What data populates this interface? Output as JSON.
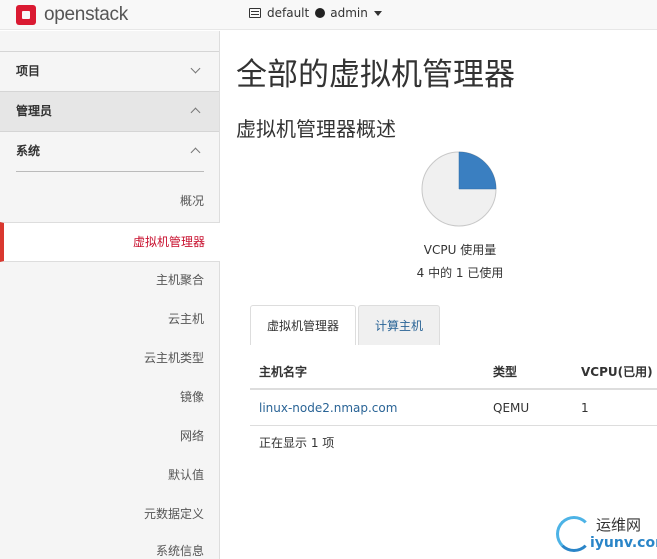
{
  "brand": {
    "name": "openstack"
  },
  "topbar": {
    "project": "default",
    "user": "admin"
  },
  "sidebar": {
    "project_label": "项目",
    "admin_label": "管理员",
    "system_label": "系统",
    "items": [
      {
        "label": "概况"
      },
      {
        "label": "虚拟机管理器"
      },
      {
        "label": "主机聚合"
      },
      {
        "label": "云主机"
      },
      {
        "label": "云主机类型"
      },
      {
        "label": "镜像"
      },
      {
        "label": "网络"
      },
      {
        "label": "默认值"
      },
      {
        "label": "元数据定义"
      },
      {
        "label": "系统信息"
      }
    ],
    "active_index": 1
  },
  "main": {
    "page_title": "全部的虚拟机管理器",
    "section_title": "虚拟机管理器概述"
  },
  "chart_data": {
    "type": "pie",
    "title": "VCPU 使用量",
    "subtitle": "4 中的 1 已使用",
    "used": 1,
    "total": 4,
    "colors": {
      "used": "#3a7fc1",
      "free": "#f0f0f0"
    }
  },
  "tabs": [
    {
      "label": "虚拟机管理器"
    },
    {
      "label": "计算主机"
    }
  ],
  "table": {
    "headers": [
      "主机名字",
      "类型",
      "VCPU(已用)"
    ],
    "rows": [
      {
        "hostname": "linux-node2.nmap.com",
        "type": "QEMU",
        "vcpu_used": "1"
      }
    ],
    "footer": "正在显示 1 项"
  },
  "watermark": {
    "cn": "运维网",
    "en": "iyunv.com"
  }
}
